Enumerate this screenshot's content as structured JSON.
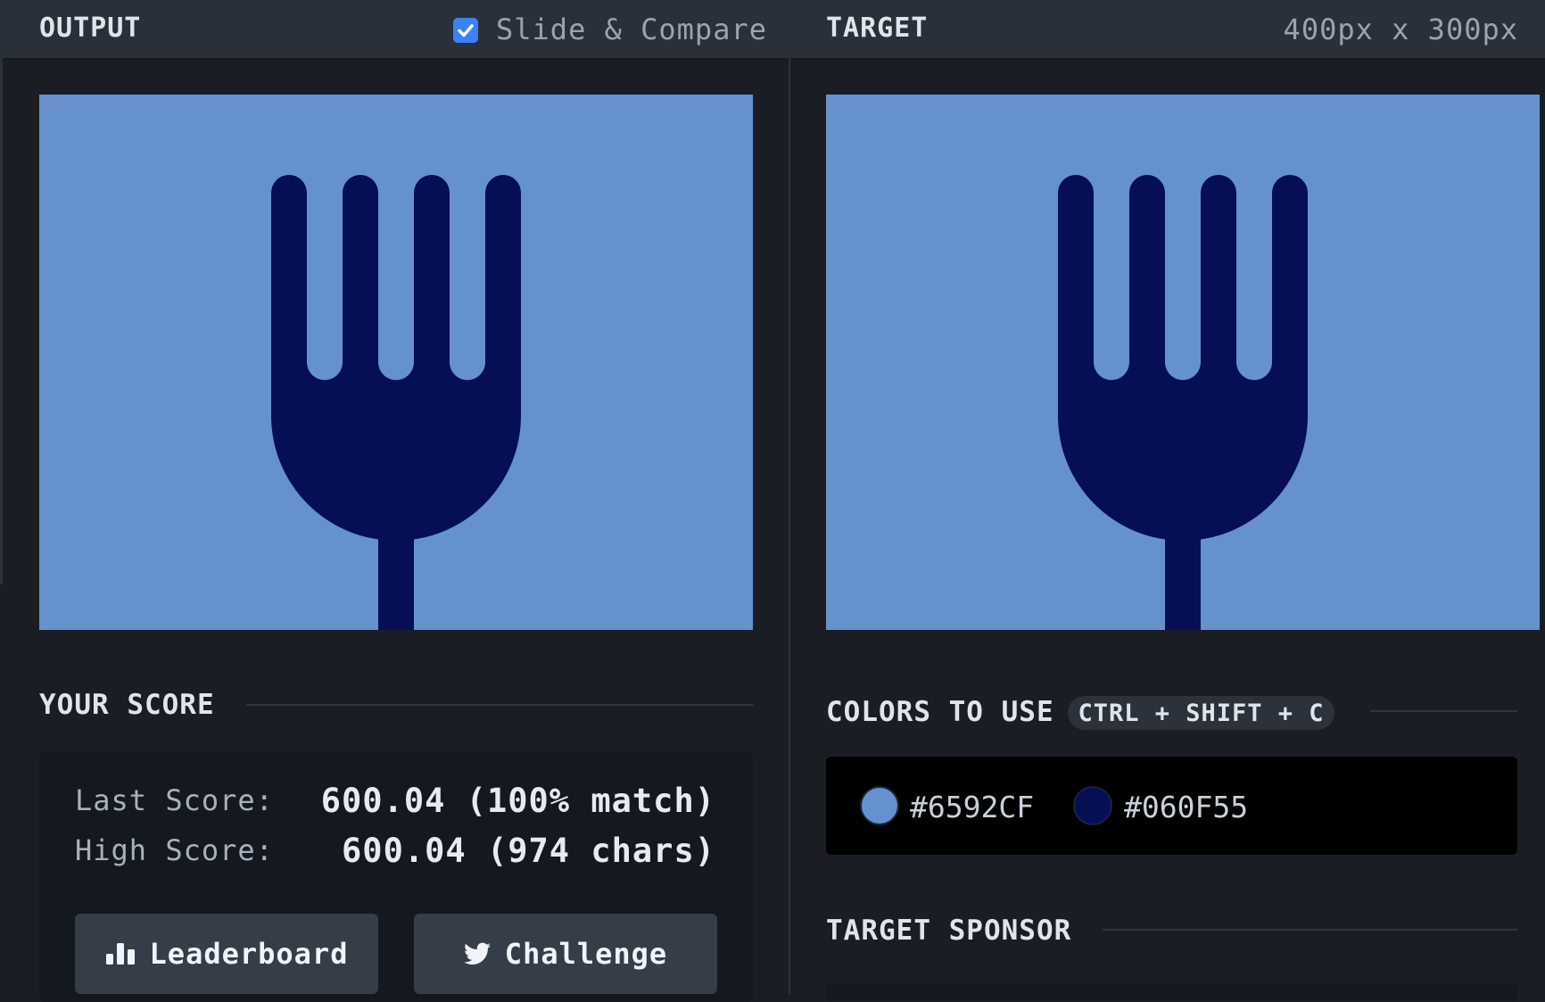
{
  "output_panel": {
    "title": "OUTPUT",
    "slide_compare": {
      "label": "Slide & Compare",
      "checked": true
    }
  },
  "target_panel": {
    "title": "TARGET",
    "dimensions": "400px x 300px"
  },
  "canvas_colors": {
    "background": "#6592CF",
    "fork": "#060F55"
  },
  "score": {
    "title": "YOUR SCORE",
    "last_label": "Last Score:",
    "last_value": "600.04 (100% match)",
    "high_label": "High Score:",
    "high_value": "600.04 (974 chars)"
  },
  "buttons": {
    "leaderboard": {
      "label": "Leaderboard",
      "icon": "bar-chart-icon"
    },
    "challenge": {
      "label": "Challenge",
      "icon": "twitter-icon"
    }
  },
  "colors_to_use": {
    "title": "COLORS TO USE",
    "shortcut": "CTRL + SHIFT + C",
    "colors": [
      {
        "hex": "#6592CF",
        "label": "#6592CF"
      },
      {
        "hex": "#060F55",
        "label": "#060F55"
      }
    ]
  },
  "sponsor": {
    "title": "TARGET SPONSOR"
  }
}
